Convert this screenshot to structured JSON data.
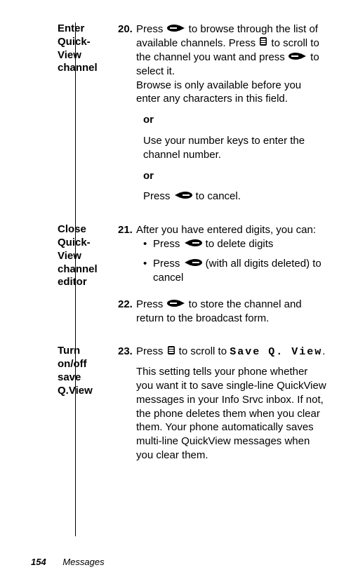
{
  "sections": [
    {
      "label": "Enter Quick-View channel",
      "steps": [
        {
          "num": "20.",
          "pre1": "Press ",
          "icon1": "right-key",
          "mid1": " to browse through the list of available channels. Press ",
          "icon2": "scroll-key",
          "mid2": " to scroll to the channel you want and press ",
          "icon3": "right-key",
          "mid3": " to select it.",
          "extra": "Browse is only available before you enter any characters in this field."
        }
      ],
      "or1": "or",
      "alt1": "Use your number keys to enter the channel number.",
      "or2": "or",
      "alt2_pre": "Press ",
      "alt2_icon": "left-key",
      "alt2_post": " to cancel."
    },
    {
      "label": "Close Quick-View channel editor",
      "steps": [
        {
          "num": "21.",
          "pre1": "After you have entered digits, you can:",
          "bullets": [
            {
              "pre": "Press ",
              "icon": "left-key",
              "post": " to delete digits"
            },
            {
              "pre": "Press ",
              "icon": "left-key",
              "post": " (with all digits deleted) to cancel"
            }
          ]
        },
        {
          "num": "22.",
          "pre1": "Press ",
          "icon1": "right-key",
          "mid1": " to store the channel and return to the broadcast form."
        }
      ]
    },
    {
      "label": "Turn on/off save Q.View",
      "steps": [
        {
          "num": "23.",
          "pre1": "Press ",
          "icon1": "scroll-key",
          "mid1": " to scroll to ",
          "mono": "Save Q. View",
          "mid2": ".",
          "para": "This setting tells your phone whether you want it to save single-line QuickView messages in your Info Srvc inbox. If not, the phone deletes them when you clear them. Your phone automatically saves multi-line QuickView messages when you clear them."
        }
      ]
    }
  ],
  "footer": {
    "page": "154",
    "section": "Messages"
  }
}
